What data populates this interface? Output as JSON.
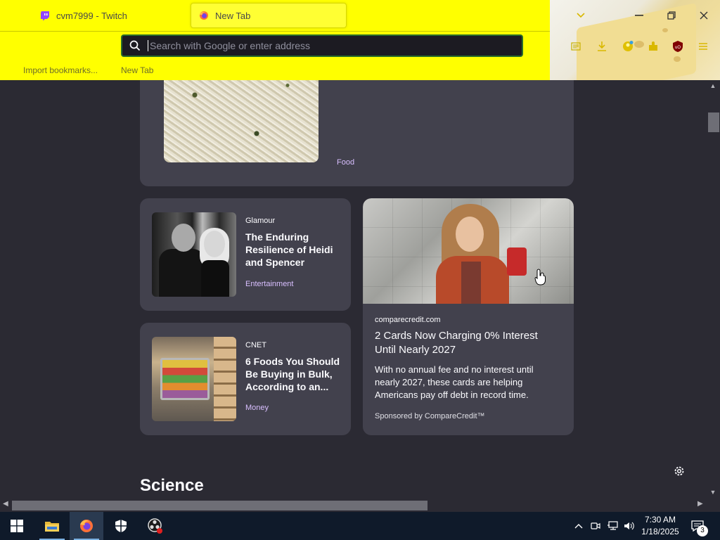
{
  "browser": {
    "tabs": [
      {
        "label": "cvm7999 - Twitch",
        "active": false
      },
      {
        "label": "New Tab",
        "active": true
      }
    ],
    "url": {
      "value": "",
      "placeholder": "Search with Google or enter address"
    },
    "bookmarks": [
      "Import bookmarks...",
      "New Tab"
    ],
    "colors": {
      "chrome": "#ffff00",
      "urlbar": "#1c1b22",
      "page_bg": "#2b2a33",
      "card_bg": "#42414d"
    }
  },
  "content": {
    "food_card": {
      "tag": "Food"
    },
    "glamour_card": {
      "source": "Glamour",
      "title_lines": [
        "The Enduring",
        "Resilience of Heidi",
        "and Spencer"
      ],
      "tag": "Entertainment"
    },
    "cnet_card": {
      "source": "CNET",
      "title_lines": [
        "6 Foods You Should",
        "Be Buying in Bulk,",
        "According to an..."
      ],
      "tag": "Money"
    },
    "ad_card": {
      "source": "comparecredit.com",
      "title_lines": [
        "2 Cards Now Charging 0% Interest",
        "Until Nearly 2027"
      ],
      "desc_lines": [
        "With no annual fee and no interest until",
        "nearly 2027, these cards are helping",
        "Americans pay off debt in record time."
      ],
      "sponsor": "Sponsored by CompareCredit™"
    },
    "section_title": "Science"
  },
  "taskbar": {
    "clock_time": "7:30 AM",
    "clock_date": "1/18/2025",
    "notification_count": "3"
  }
}
